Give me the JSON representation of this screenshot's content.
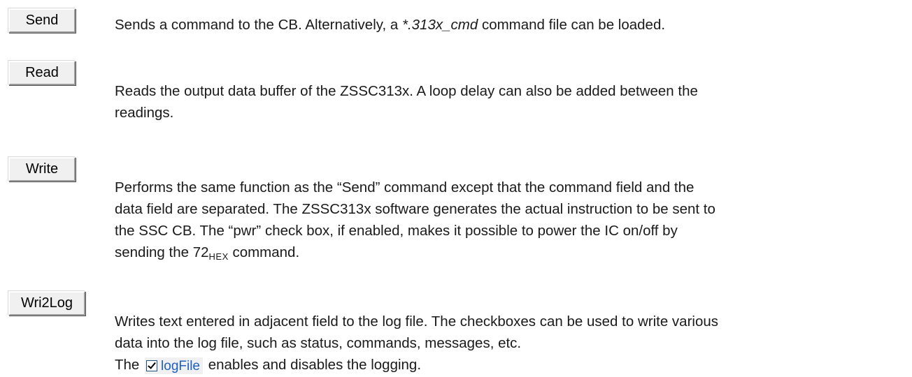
{
  "buttons": {
    "send": "Send",
    "read": "Read",
    "write": "Write",
    "wri2log": "Wri2Log"
  },
  "descriptions": {
    "send": {
      "pre": "Sends a command to the CB. Alternatively, a ",
      "italic": "*.313x_cmd",
      "post": " command file can be loaded."
    },
    "read": {
      "line1": "Reads the output data buffer of the ZSSC313x. A loop delay can also be added between the",
      "line2": "readings."
    },
    "write": {
      "line1": "Performs the same function as the “Send” command except that the command field and the",
      "line2": "data field are separated. The ZSSC313x software generates the actual instruction to be sent to",
      "line3": "the SSC CB. The “pwr” check box, if enabled, makes it possible to power the IC on/off by",
      "line4_pre": "sending the 72",
      "line4_sub": "HEX",
      "line4_post": " command."
    },
    "wri2log": {
      "line1": "Writes text entered in adjacent field to the log file. The checkboxes can be used to write various",
      "line2": "data into the log file, such as status, commands, messages, etc.",
      "line3_pre": "The ",
      "checkbox_label": "logFile",
      "checkbox_checked": true,
      "line3_post": " enables and disables the logging."
    }
  },
  "colors": {
    "button_face": "#f0f0f0",
    "text": "#1a1a1a",
    "checkbox_label": "#1f5fbf"
  }
}
